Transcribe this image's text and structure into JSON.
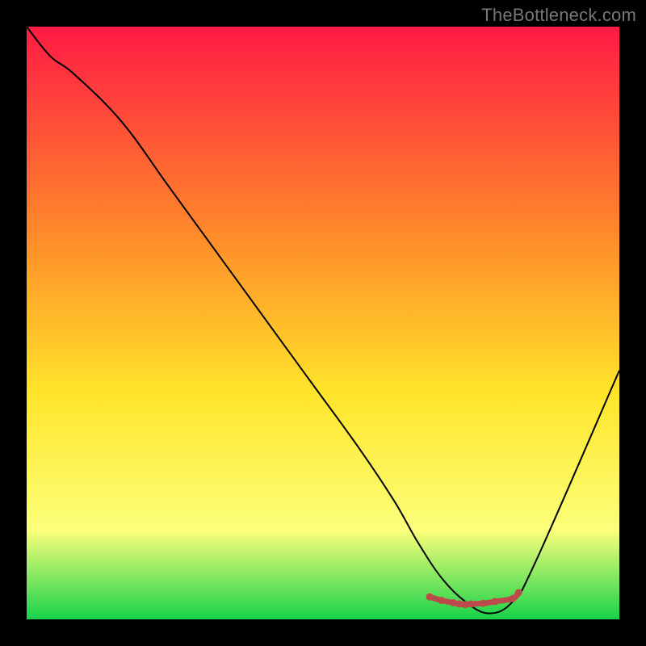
{
  "watermark": "TheBottleneck.com",
  "chart_data": {
    "type": "line",
    "title": "",
    "xlabel": "",
    "ylabel": "",
    "xlim": [
      0,
      100
    ],
    "ylim": [
      0,
      100
    ],
    "grid": false,
    "legend": false,
    "series": [
      {
        "name": "main-curve",
        "x": [
          0,
          4,
          8,
          16,
          24,
          32,
          40,
          48,
          56,
          62,
          66,
          70,
          74,
          78,
          82,
          86,
          100
        ],
        "y": [
          100,
          95,
          92,
          84,
          73,
          62,
          51,
          40,
          29,
          20,
          13,
          7,
          3,
          1,
          3,
          10,
          42
        ],
        "color": "#000000"
      },
      {
        "name": "bottleneck-marker",
        "x": [
          68,
          70,
          72,
          73,
          74,
          75,
          77,
          79,
          82,
          83
        ],
        "y": [
          3.8,
          3.2,
          2.8,
          2.6,
          2.5,
          2.6,
          2.7,
          3.0,
          3.5,
          4.5
        ],
        "color": "#bd4a4a"
      }
    ],
    "background_gradient": {
      "top": "#ff1a44",
      "mid1": "#ff8a2a",
      "mid2": "#ffe52a",
      "mid3": "#fbff7a",
      "bottom": "#18d24a"
    }
  }
}
